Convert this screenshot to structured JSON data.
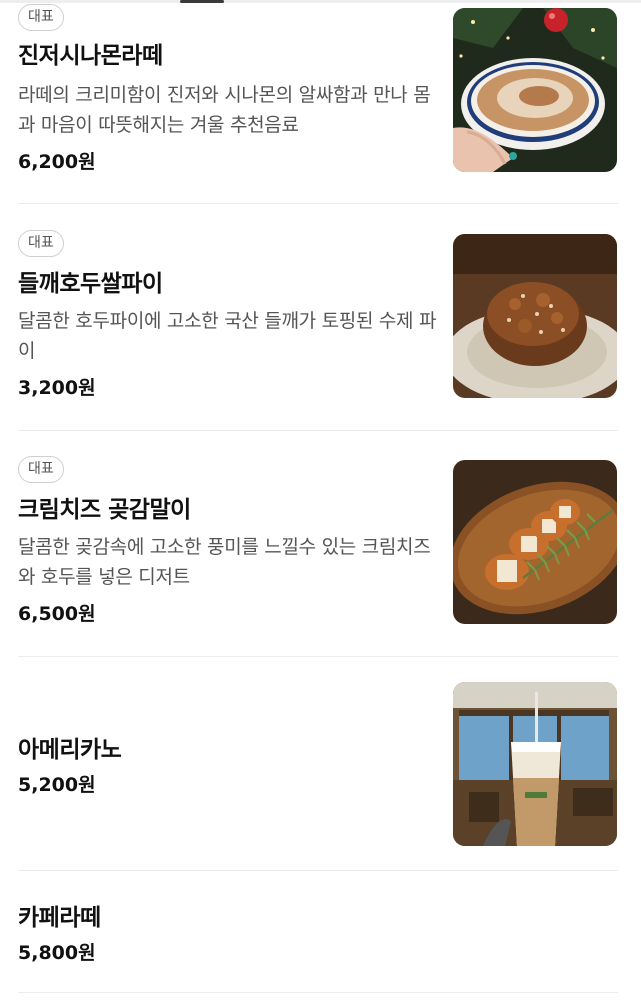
{
  "menu": {
    "items": [
      {
        "badge": "대표",
        "name": "진저시나몬라떼",
        "description": "라떼의 크리미함이 진저와 시나몬의 알싸함과 만나 몸과 마음이 따뜻해지는 겨울 추천음료",
        "price": "6,200원",
        "image_icon": "cinnamon-latte-photo"
      },
      {
        "badge": "대표",
        "name": "들깨호두쌀파이",
        "description": "달콤한 호두파이에 고소한 국산 들깨가 토핑된 수제 파이",
        "price": "3,200원",
        "image_icon": "walnut-pie-photo"
      },
      {
        "badge": "대표",
        "name": "크림치즈 곶감말이",
        "description": "달콤한 곶감속에 고소한 풍미를 느낄수 있는 크림치즈와 호두를 넣은 디저트",
        "price": "6,500원",
        "image_icon": "persimmon-roll-photo"
      },
      {
        "name": "아메리카노",
        "price": "5,200원",
        "image_icon": "iced-americano-photo"
      },
      {
        "name": "카페라떼",
        "price": "5,800원"
      }
    ]
  }
}
